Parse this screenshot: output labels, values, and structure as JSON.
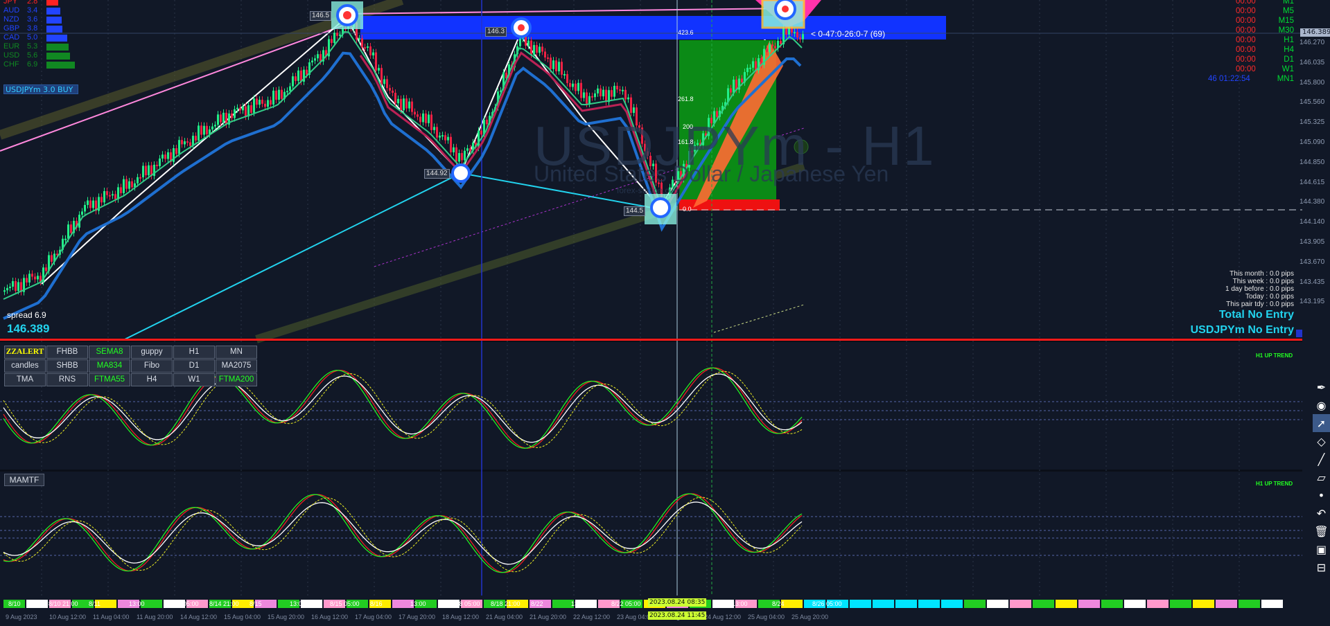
{
  "strength": [
    {
      "label": "JPY",
      "value": "2.8",
      "color": "#ff2222",
      "bar": 0.28
    },
    {
      "label": "AUD",
      "value": "3.4",
      "color": "#2244ff",
      "bar": 0.34
    },
    {
      "label": "NZD",
      "value": "3.6",
      "color": "#2244ff",
      "bar": 0.36
    },
    {
      "label": "GBP",
      "value": "3.8",
      "color": "#2244ff",
      "bar": 0.38
    },
    {
      "label": "CAD",
      "value": "5.0",
      "color": "#2244ff",
      "bar": 0.5
    },
    {
      "label": "EUR",
      "value": "5.3",
      "color": "#118822",
      "bar": 0.53
    },
    {
      "label": "USD",
      "value": "5.6",
      "color": "#118822",
      "bar": 0.56
    },
    {
      "label": "CHF",
      "value": "6.9",
      "color": "#118822",
      "bar": 0.69
    }
  ],
  "signal": "USDJPYm 3.0 BUY",
  "timeframes": [
    {
      "time": "00:00",
      "name": "M1"
    },
    {
      "time": "00:00",
      "name": "M5"
    },
    {
      "time": "00:00",
      "name": "M15"
    },
    {
      "time": "00:00",
      "name": "M30"
    },
    {
      "time": "00:00",
      "name": "H1"
    },
    {
      "time": "00:00",
      "name": "H4"
    },
    {
      "time": "00:00",
      "name": "D1"
    },
    {
      "time": "00:00",
      "name": "W1"
    },
    {
      "time": "46 01:22:54",
      "name": "MN1"
    }
  ],
  "watermark": {
    "symbol": "USDJPYm - H1",
    "description": "United States Dollar / Japanese Yen",
    "site": "forex-station.com"
  },
  "zigzag_text": "< 0-47:0-26:0-7 (69)",
  "price_axis": [
    "146.270",
    "146.035",
    "145.800",
    "145.560",
    "145.325",
    "145.090",
    "144.850",
    "144.615",
    "144.380",
    "144.140",
    "143.905",
    "143.670",
    "143.435",
    "143.195"
  ],
  "price_marker": "146.389",
  "fib_levels": [
    "423.6",
    "261.8",
    "200",
    "161.8",
    "0.0"
  ],
  "points": [
    "146.5",
    "146.3",
    "144.92",
    "144.5"
  ],
  "stats": [
    "This month : 0.0 pips",
    "This week : 0.0 pips",
    "1 day before : 0.0 pips",
    "Today : 0.0 pips",
    "This pair tdy : 0.0 pips"
  ],
  "total_entry": "Total No Entry",
  "pair_entry": "USDJPYm No Entry",
  "spread": "spread 6.9",
  "bid": "146.389",
  "buttons": [
    {
      "label": "ZZALERT",
      "state": "alert"
    },
    {
      "label": "FHBB",
      "state": "off"
    },
    {
      "label": "SEMA8",
      "state": "on"
    },
    {
      "label": "guppy",
      "state": "off"
    },
    {
      "label": "H1",
      "state": "off"
    },
    {
      "label": "MN",
      "state": "off"
    },
    {
      "label": "candles",
      "state": "off"
    },
    {
      "label": "SHBB",
      "state": "off"
    },
    {
      "label": "MA834",
      "state": "on"
    },
    {
      "label": "Fibo",
      "state": "off"
    },
    {
      "label": "D1",
      "state": "off"
    },
    {
      "label": "MA2075",
      "state": "off"
    },
    {
      "label": "TMA",
      "state": "off"
    },
    {
      "label": "RNS",
      "state": "off"
    },
    {
      "label": "FTMA55",
      "state": "on"
    },
    {
      "label": "H4",
      "state": "off"
    },
    {
      "label": "W1",
      "state": "off"
    },
    {
      "label": "FTMA200",
      "state": "on"
    }
  ],
  "mamtf": "MAMTF",
  "trend_label": "H1 UP TREND",
  "strip_labels": [
    "8/10",
    "8/10 21:00",
    "8/11",
    "13:00",
    "8/15 05:00",
    "8/14 21:00",
    "8/15",
    "13:00",
    "8/15 05:00",
    "8/16",
    "13:00",
    "8/18 05:00",
    "8/18 21:00",
    "8/22",
    "13:00",
    "8/22 05:00",
    "8/22 21:00",
    "8/23",
    "13:00",
    "8/24",
    "8/26 05:00"
  ],
  "date_labels": [
    "9 Aug 2023",
    "10 Aug 12:00",
    "11 Aug 04:00",
    "11 Aug 20:00",
    "14 Aug 12:00",
    "15 Aug 04:00",
    "15 Aug 20:00",
    "16 Aug 12:00",
    "17 Aug 04:00",
    "17 Aug 20:00",
    "18 Aug 12:00",
    "21 Aug 04:00",
    "21 Aug 20:00",
    "22 Aug 12:00",
    "23 Aug 04:00",
    "23 Aug 20:00",
    "24 Aug 12:00",
    "25 Aug 04:00",
    "25 Aug 20:00"
  ],
  "crosshair_date": "2023.08.24 08:35",
  "crosshair_date2": "2023.08.24 11:45",
  "colors": {
    "bg": "#111827",
    "bull": "#22ee88",
    "bear": "#ee2244",
    "accent": "#22d3ee"
  }
}
